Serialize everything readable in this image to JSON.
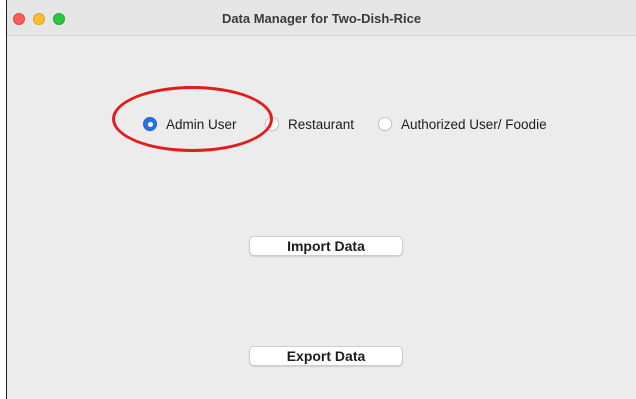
{
  "window": {
    "title": "Data Manager for Two-Dish-Rice"
  },
  "user_type": {
    "selected": "Admin User",
    "options": [
      {
        "label": "Admin User",
        "selected": true
      },
      {
        "label": "Restaurant",
        "selected": false
      },
      {
        "label": "Authorized User/ Foodie",
        "selected": false
      }
    ]
  },
  "actions": {
    "import_label": "Import Data",
    "export_label": "Export Data"
  },
  "colors": {
    "accent": "#2872e8",
    "annotation": "#e41b1b",
    "close": "#ff5f57",
    "minimize": "#febc2e",
    "zoom": "#28c840"
  }
}
